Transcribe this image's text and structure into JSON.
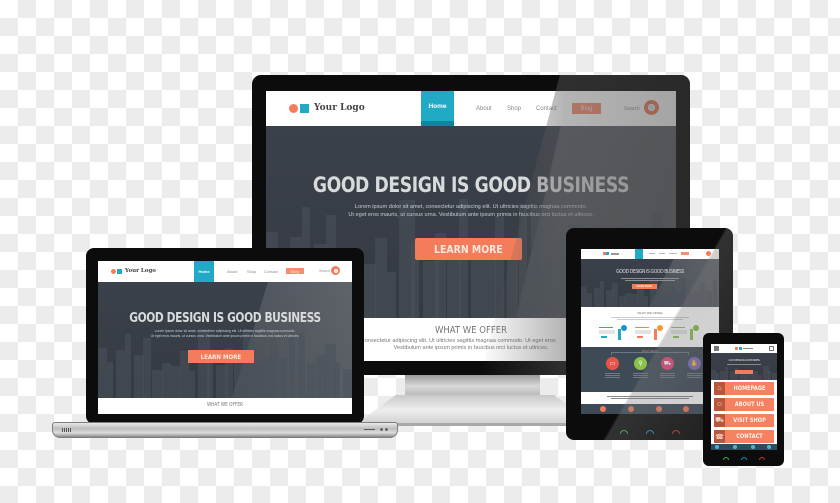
{
  "scene": {
    "description": "Responsive web design mockup on monitor, laptop, tablet and phone",
    "colors": {
      "accent_orange": "#f47c5a",
      "accent_teal": "#21aac6",
      "hero_dark": "#3b414a",
      "bezel": "#0c0c0c"
    }
  },
  "website": {
    "logo": {
      "text": "Your Logo",
      "icon": "logo-circle-square-icon"
    },
    "nav": {
      "home": "Home",
      "about": "About",
      "shop": "Shop",
      "contact": "Contact",
      "blog": "Blog",
      "search_label": "Search",
      "search_icon": "magnifier-icon"
    },
    "hero": {
      "title": "GOOD DESIGN IS GOOD BUSINESS",
      "subtitle_line1": "Lorem ipsum dolor sit amet, consectetur adipiscing elit. Ut ultricies sagittis magnaa commodo.",
      "subtitle_line2": "Ut eget eros mauris, ut cursus urna. Vestibulum ante ipsum primis in faucibus orci luctus et ultrices.",
      "cta": "LEARN MORE"
    },
    "offer": {
      "title": "WHAT WE OFFER",
      "line1": "amet, consectetur adipiscing elit. Ut ultricies sagittis magnaa commodo. Ut eget eros",
      "line2": "Vestibulum ante ipsum primis in faucibus orci luctus et ultrices."
    }
  },
  "tablet": {
    "hero_title": "GOOD DESIGN IS GOOD BUSINESS",
    "cta": "LEARN MORE",
    "offer_title": "WHAT WE OFFER",
    "section_title": "WHAT WE DO",
    "services": [
      {
        "icon": "monitor-icon",
        "color": "#e8534a",
        "glyph": "▭"
      },
      {
        "icon": "search-icon",
        "color": "#8bc34a",
        "glyph": "⚲"
      },
      {
        "icon": "cart-icon",
        "color": "#e8457a",
        "glyph": "⛟"
      },
      {
        "icon": "thumbs-up-icon",
        "color": "#7e6bc4",
        "glyph": "✋"
      }
    ],
    "footer_icons": [
      "phone-icon",
      "mail-icon",
      "location-icon",
      "share-icon"
    ],
    "keys": [
      {
        "icon": "call-icon",
        "color": "#3cae4a"
      },
      {
        "icon": "home-icon",
        "color": "#1e90d0"
      },
      {
        "icon": "hangup-icon",
        "color": "#d0312d"
      }
    ]
  },
  "phone": {
    "hero_title": "GOOD DESIGN IS GOOD BUSINESS",
    "buttons": [
      {
        "label": "HOMEPAGE",
        "icon": "home-icon",
        "glyph": "⌂"
      },
      {
        "label": "ABOUT US",
        "icon": "person-icon",
        "glyph": "☺"
      },
      {
        "label": "VISIT SHOP",
        "icon": "cart-icon",
        "glyph": "⛟"
      },
      {
        "label": "CONTACT",
        "icon": "phone-icon",
        "glyph": "☎"
      }
    ]
  },
  "laptop": {
    "offer_title": "WHAT WE OFFER"
  }
}
